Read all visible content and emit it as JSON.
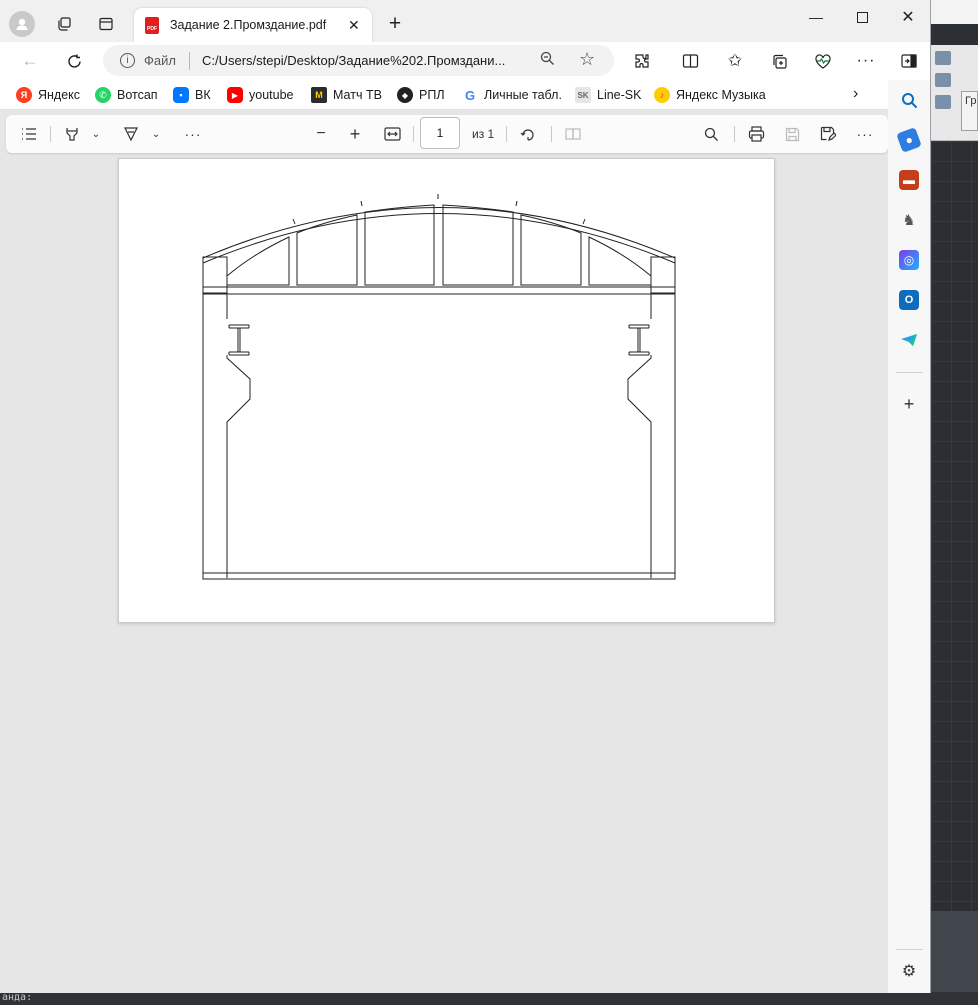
{
  "tab": {
    "title": "Задание 2.Промздание.pdf",
    "favicon_label": "PDF"
  },
  "address": {
    "file_label": "Файл",
    "url": "C:/Users/stepi/Desktop/Задание%202.Промздани..."
  },
  "bookmarks": [
    {
      "label": "Яндекс",
      "icon": "yandex-icon",
      "color": "#fc3f1d",
      "glyph": "Я"
    },
    {
      "label": "Вотсап",
      "icon": "whatsapp-icon",
      "color": "#25d366",
      "glyph": "✆"
    },
    {
      "label": "ВК",
      "icon": "vk-icon",
      "color": "#0077ff",
      "glyph": "▪"
    },
    {
      "label": "youtube",
      "icon": "youtube-icon",
      "color": "#ff0000",
      "glyph": "▶"
    },
    {
      "label": "Матч ТВ",
      "icon": "match-tv-icon",
      "color": "#2b2b2b",
      "glyph": "M"
    },
    {
      "label": "РПЛ",
      "icon": "rpl-icon",
      "color": "#222222",
      "glyph": "◆"
    },
    {
      "label": "Личные табл.",
      "icon": "google-icon",
      "color": "#4285f4",
      "glyph": "G"
    },
    {
      "label": "Line-SK",
      "icon": "line-sk-icon",
      "color": "#8a8a8a",
      "glyph": "SK"
    },
    {
      "label": "Яндекс Музыка",
      "icon": "yandex-music-icon",
      "color": "#ffcc00",
      "glyph": "♪"
    }
  ],
  "pdf": {
    "page_current": "1",
    "page_total": "из 1"
  },
  "cmd_label": "анда:",
  "bg_app": {
    "ribbon_label": "Гр"
  }
}
